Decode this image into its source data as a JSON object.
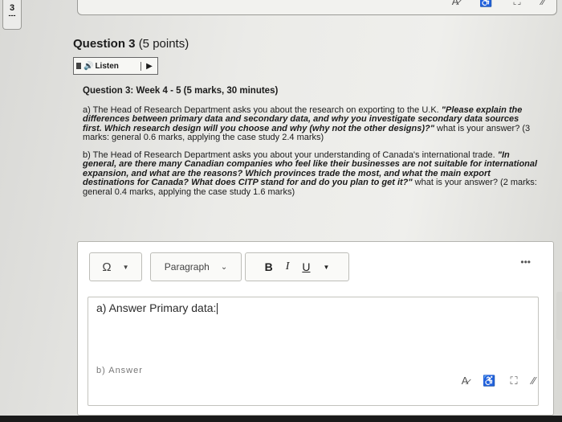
{
  "question_nav": {
    "number": "3",
    "marker": "---"
  },
  "top_toolbar": {
    "icons": [
      "spellcheck-icon",
      "accessibility-icon",
      "fullscreen-icon",
      "resize-icon"
    ],
    "glyphs": [
      "A̷",
      "♿",
      "⛶",
      "⁄⁄"
    ]
  },
  "question": {
    "title": "Question 3",
    "points": "(5 points)",
    "listen_label": "Listen",
    "heading": "Question 3: Week 4 - 5 (5 marks, 30 minutes)",
    "part_a_intro": "a) The Head of Research Department asks you about the research on exporting to the U.K. ",
    "part_a_quote": "\"Please explain the differences between primary data and secondary data, and why you investigate secondary data sources first. Which research design will you choose and why (why not the other designs)?\"",
    "part_a_tail": " what is your answer? (3 marks: general 0.6 marks, applying the case study 2.4 marks)",
    "part_b_intro": "b) The Head of Research Department asks you about your understanding of Canada's international trade. ",
    "part_b_quote": "\"In general, are there many Canadian companies who feel like their businesses are not suitable for international expansion, and what are the reasons? Which provinces trade the most, and what the main export destinations for Canada? What does CITP stand for and do you plan to get it?\"",
    "part_b_tail": " what is your answer? (2 marks: general 0.4 marks, applying the case study 1.6 marks)"
  },
  "editor": {
    "paragraph_select": "Paragraph",
    "bold": "B",
    "italic": "I",
    "underline": "U",
    "more": "•••",
    "omega": "Ω",
    "answer_line_a": "a) Answer Primary data:",
    "answer_line_b": "b) Answer"
  }
}
